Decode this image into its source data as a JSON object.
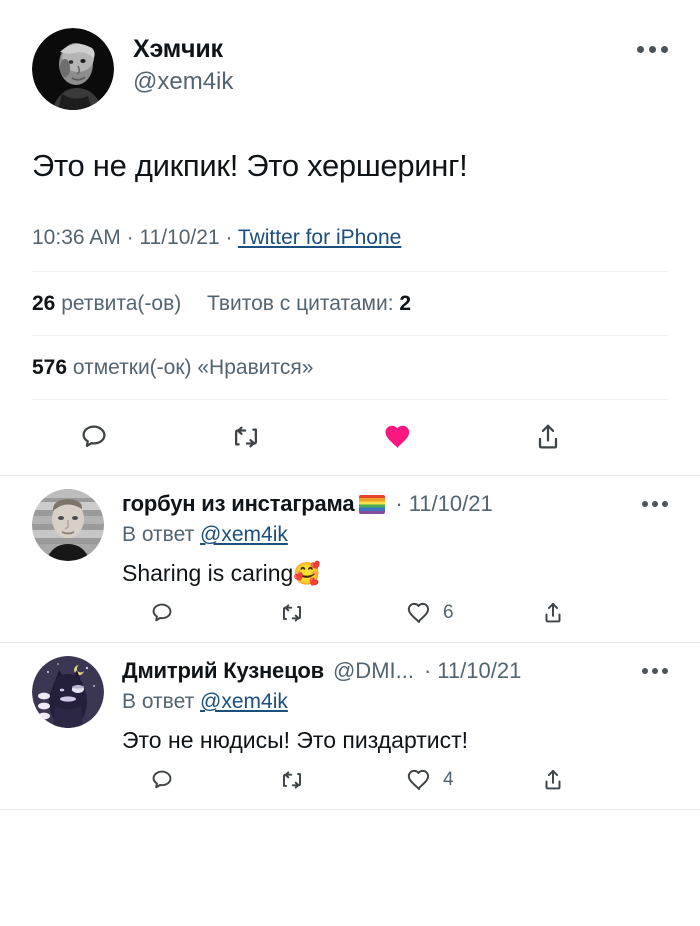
{
  "main_tweet": {
    "display_name": "Хэмчик",
    "handle": "@xem4ik",
    "text": "Это не дикпик! Это хершеринг!",
    "time": "10:36 AM",
    "separator_1": "·",
    "date": "11/10/21",
    "separator_2": "·",
    "source": "Twitter for iPhone",
    "retweets_count": "26",
    "retweets_label": "ретвита(-ов)",
    "quotes_label": "Твитов с цитатами:",
    "quotes_count": "2",
    "likes_count": "576",
    "likes_label": "отметки(-ок) «Нравится»",
    "more_icon": "more-horizontal-icon",
    "liked": true,
    "like_color": "#f91880",
    "actions": {
      "reply": "",
      "retweet": "",
      "like": "",
      "share": ""
    }
  },
  "replies": [
    {
      "display_name": "горбун из инстаграма",
      "emoji": "rainbow-flag",
      "separator": "·",
      "date": "11/10/21",
      "reply_to_prefix": "В ответ",
      "reply_to_handle": "@xem4ik",
      "text": "Sharing is caring",
      "text_emoji": "🥰",
      "like_count": "6",
      "reply_count": "",
      "retweet_count": "",
      "share_count": ""
    },
    {
      "display_name": "Дмитрий Кузнецов",
      "handle": "@DMI...",
      "separator": "·",
      "date": "11/10/21",
      "reply_to_prefix": "В ответ",
      "reply_to_handle": "@xem4ik",
      "text": "Это не нюдисы! Это пиздартист!",
      "text_emoji": "",
      "like_count": "4",
      "reply_count": "",
      "retweet_count": "",
      "share_count": ""
    }
  ],
  "colors": {
    "text": "#0f1419",
    "muted": "#536471",
    "link": "#1b4f7d",
    "divider": "#eff3f4",
    "like_pink": "#f91880"
  }
}
